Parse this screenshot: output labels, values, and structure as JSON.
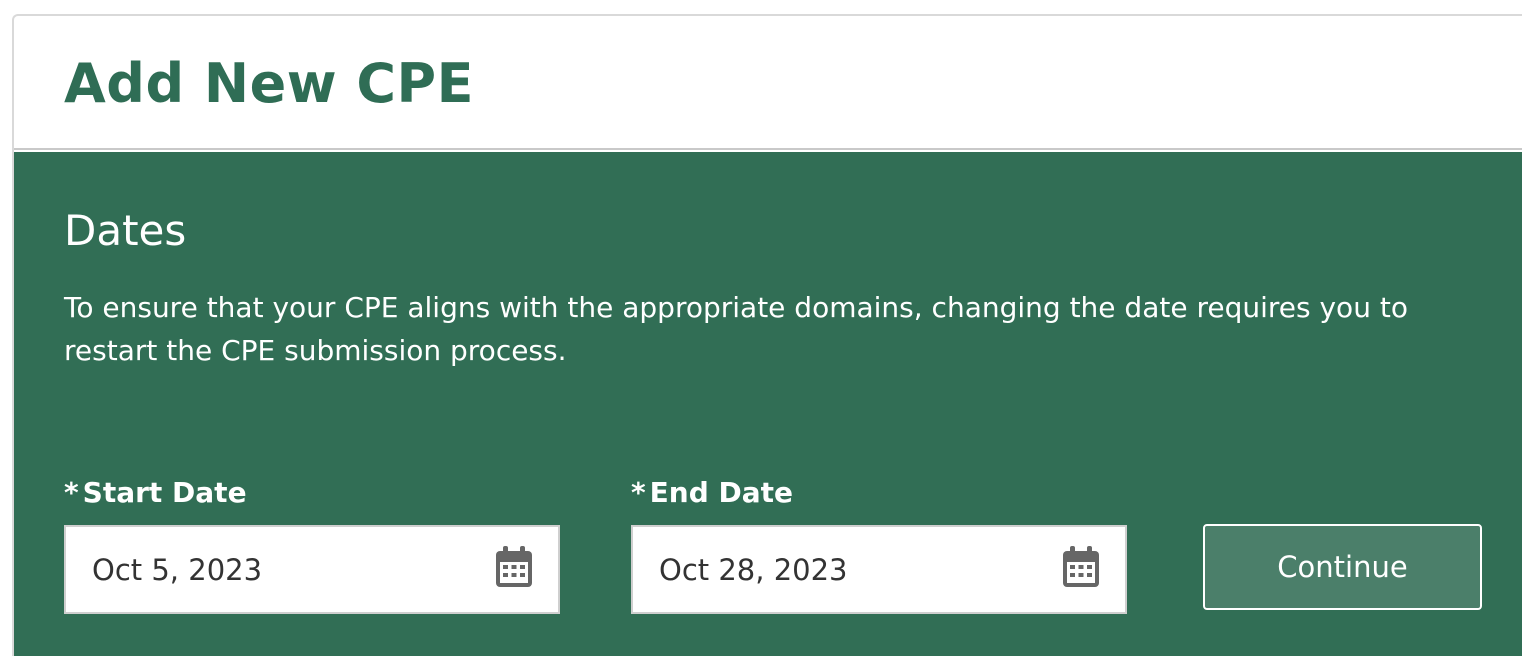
{
  "page": {
    "title": "Add New CPE"
  },
  "dates_section": {
    "title": "Dates",
    "description": "To ensure that your CPE aligns with the appropriate domains, changing the date requires you to restart the CPE submission process.",
    "start_date": {
      "required_marker": "*",
      "label": "Start Date",
      "value": "Oct 5, 2023",
      "icon": "calendar-icon"
    },
    "end_date": {
      "required_marker": "*",
      "label": "End Date",
      "value": "Oct 28, 2023",
      "icon": "calendar-icon"
    },
    "continue_label": "Continue"
  },
  "colors": {
    "brand_green": "#316e55",
    "title_green": "#2f6d55",
    "button_fill": "#4b7f6a",
    "icon_gray": "#666666"
  }
}
